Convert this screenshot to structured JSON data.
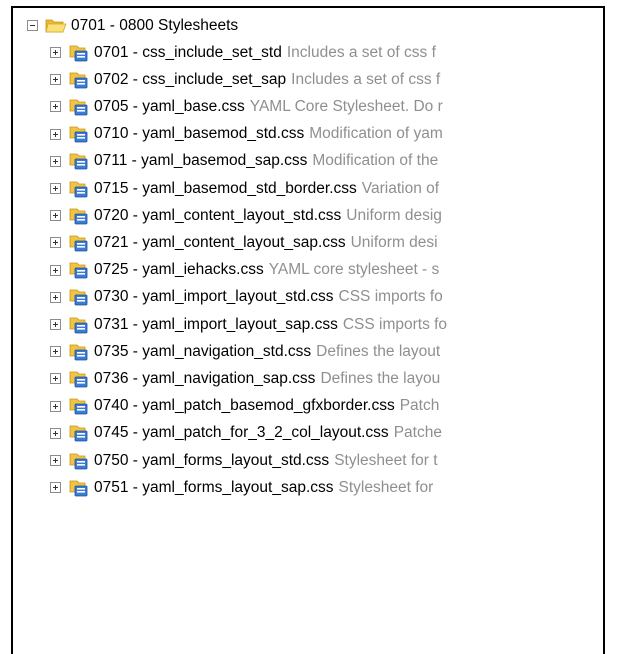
{
  "tree": {
    "parent": {
      "label": "0701 - 0800 Stylesheets",
      "expanded": true,
      "icon": "folder-open-icon"
    },
    "items": [
      {
        "name": "0701 - css_include_set_std",
        "desc": "Includes a set of css f",
        "icon": "template-icon"
      },
      {
        "name": "0702 - css_include_set_sap",
        "desc": "Includes a set of css f",
        "icon": "template-icon"
      },
      {
        "name": "0705 - yaml_base.css",
        "desc": "YAML Core Stylesheet. Do r",
        "icon": "template-icon"
      },
      {
        "name": "0710 - yaml_basemod_std.css",
        "desc": "Modification of yam",
        "icon": "template-icon"
      },
      {
        "name": "0711 - yaml_basemod_sap.css",
        "desc": "Modification of the",
        "icon": "template-icon"
      },
      {
        "name": "0715 - yaml_basemod_std_border.css",
        "desc": "Variation of",
        "icon": "template-icon"
      },
      {
        "name": "0720 - yaml_content_layout_std.css",
        "desc": "Uniform desig",
        "icon": "template-icon"
      },
      {
        "name": "0721 - yaml_content_layout_sap.css",
        "desc": "Uniform desi",
        "icon": "template-icon"
      },
      {
        "name": "0725 - yaml_iehacks.css",
        "desc": "YAML core stylesheet - s",
        "icon": "template-icon"
      },
      {
        "name": "0730 - yaml_import_layout_std.css",
        "desc": "CSS imports fo",
        "icon": "template-icon"
      },
      {
        "name": "0731 - yaml_import_layout_sap.css",
        "desc": "CSS imports fo",
        "icon": "template-icon"
      },
      {
        "name": "0735 - yaml_navigation_std.css",
        "desc": "Defines the layout",
        "icon": "template-icon"
      },
      {
        "name": "0736 - yaml_navigation_sap.css",
        "desc": "Defines the layou",
        "icon": "template-icon"
      },
      {
        "name": "0740 - yaml_patch_basemod_gfxborder.css",
        "desc": "Patch",
        "icon": "template-icon"
      },
      {
        "name": "0745 - yaml_patch_for_3_2_col_layout.css",
        "desc": "Patche",
        "icon": "template-icon"
      },
      {
        "name": "0750 - yaml_forms_layout_std.css",
        "desc": "Stylesheet for t",
        "icon": "template-icon"
      },
      {
        "name": "0751 - yaml_forms_layout_sap.css",
        "desc": "Stylesheet for",
        "icon": "template-icon"
      }
    ]
  },
  "colors": {
    "description_text": "#8f8f8f",
    "folder_yellow": "#f4c430",
    "template_blue": "#2f6fd0"
  }
}
